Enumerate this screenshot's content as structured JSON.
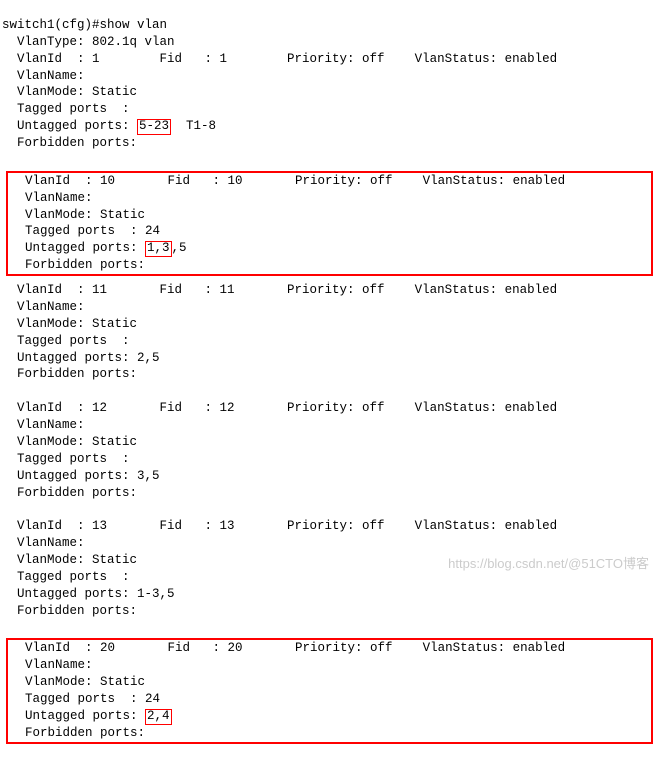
{
  "prompt": "switch1(cfg)#show vlan",
  "header": "  VlanType: 802.1q vlan",
  "vlans": [
    {
      "id": "1",
      "fid": "1",
      "priority": "off",
      "status": "enabled",
      "name": "",
      "mode": "Static",
      "tagged": "",
      "untagged_pre": "",
      "untagged_hl": "5-23",
      "untagged_post": "  T1-8",
      "forbidden": "",
      "box": false
    },
    {
      "id": "10",
      "fid": "10",
      "priority": "off",
      "status": "enabled",
      "name": "",
      "mode": "Static",
      "tagged": "24",
      "untagged_pre": "",
      "untagged_hl": "1,3",
      "untagged_post": ",5",
      "forbidden": "",
      "box": true
    },
    {
      "id": "11",
      "fid": "11",
      "priority": "off",
      "status": "enabled",
      "name": "",
      "mode": "Static",
      "tagged": "",
      "untagged_pre": "2,5",
      "untagged_hl": "",
      "untagged_post": "",
      "forbidden": "",
      "box": false
    },
    {
      "id": "12",
      "fid": "12",
      "priority": "off",
      "status": "enabled",
      "name": "",
      "mode": "Static",
      "tagged": "",
      "untagged_pre": "3,5",
      "untagged_hl": "",
      "untagged_post": "",
      "forbidden": "",
      "box": false
    },
    {
      "id": "13",
      "fid": "13",
      "priority": "off",
      "status": "enabled",
      "name": "",
      "mode": "Static",
      "tagged": "",
      "untagged_pre": "1-3,5",
      "untagged_hl": "",
      "untagged_post": "",
      "forbidden": "",
      "box": false
    },
    {
      "id": "20",
      "fid": "20",
      "priority": "off",
      "status": "enabled",
      "name": "",
      "mode": "Static",
      "tagged": "24",
      "untagged_pre": "",
      "untagged_hl": "2,4",
      "untagged_post": "",
      "forbidden": "",
      "box": true
    }
  ],
  "labels": {
    "vlanid": "  VlanId  : ",
    "fid": "     Fid   : ",
    "priority": "     Priority: ",
    "status": "   VlanStatus: ",
    "vlanname": "  VlanName:",
    "vlanmode": "  VlanMode: ",
    "tagged": "  Tagged ports  : ",
    "untagged": "  Untagged ports: ",
    "forbidden": "  Forbidden ports:"
  },
  "watermark": "https://blog.csdn.net/@51CTO博客"
}
